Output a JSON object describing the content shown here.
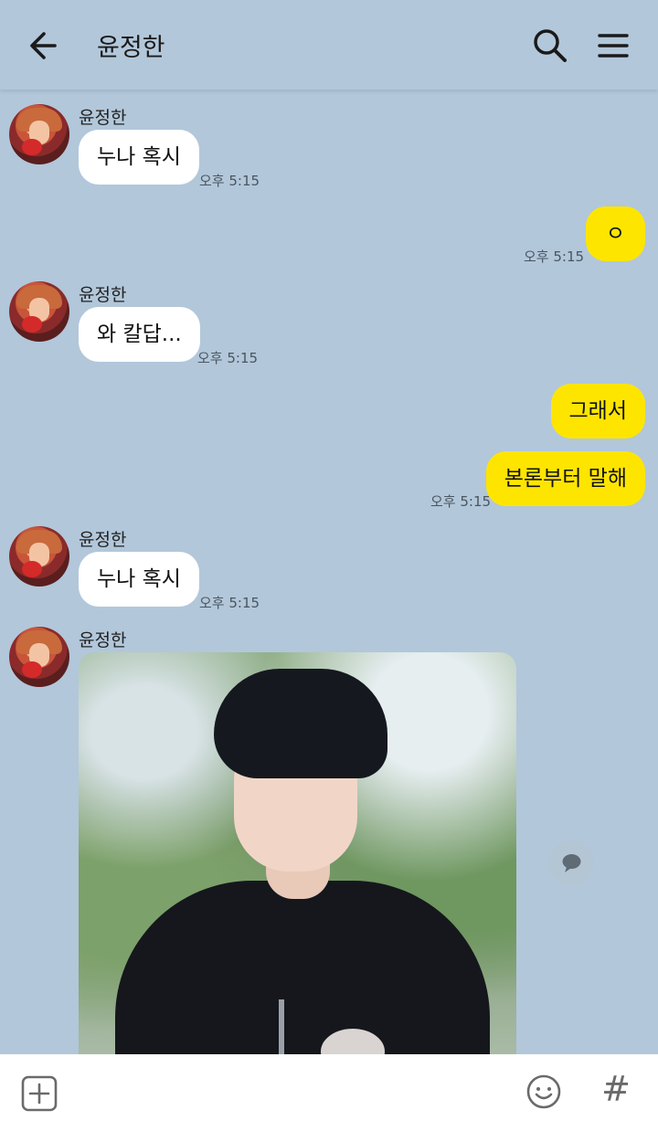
{
  "header": {
    "title": "윤정한",
    "back_icon": "back-arrow-icon",
    "search_icon": "search-icon",
    "menu_icon": "menu-icon"
  },
  "colors": {
    "background": "#b2c7da",
    "incoming_bubble": "#ffffff",
    "outgoing_bubble": "#fee500"
  },
  "messages": [
    {
      "sender": "윤정한",
      "text": "누나 혹시",
      "time": "오후 5:15"
    },
    {
      "text": "ㅇ",
      "time": "오후 5:15"
    },
    {
      "sender": "윤정한",
      "text": "와 칼답...",
      "time": "오후 5:15"
    },
    {
      "text": "그래서"
    },
    {
      "text": "본론부터 말해",
      "time": "오후 5:15"
    },
    {
      "sender": "윤정한",
      "text": "누나 혹시",
      "time": "오후 5:15"
    },
    {
      "sender": "윤정한"
    }
  ],
  "footer": {
    "plus_icon": "plus-box-icon",
    "emoji_icon": "emoji-icon",
    "hash": "#"
  }
}
